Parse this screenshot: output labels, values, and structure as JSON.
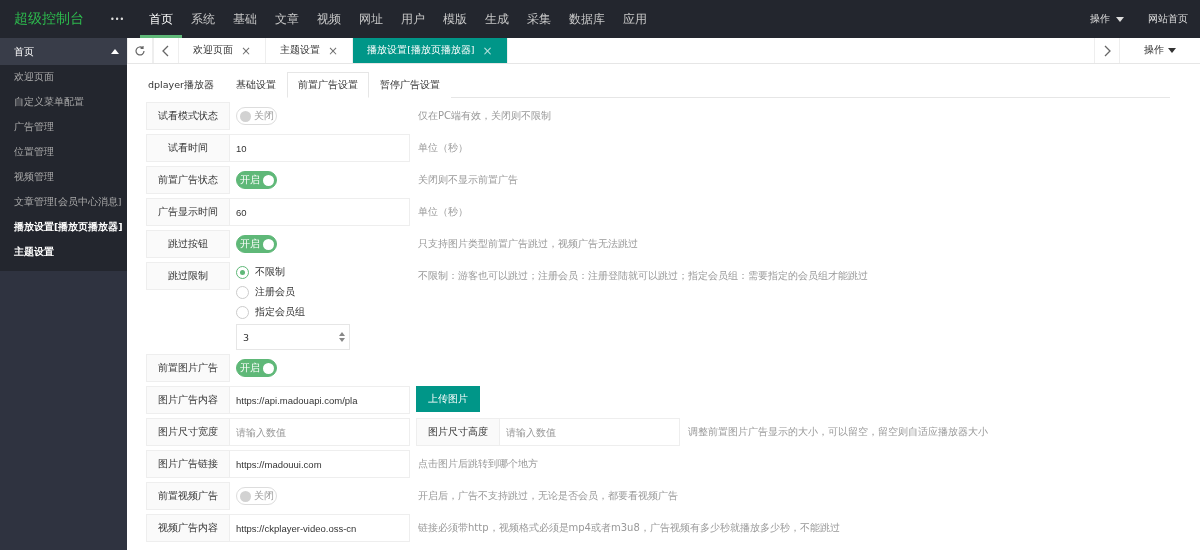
{
  "logo": "超级控制台",
  "more": "•••",
  "nav": [
    {
      "label": "首页",
      "selected": true
    },
    {
      "label": "系统",
      "selected": false
    },
    {
      "label": "基础",
      "selected": false
    },
    {
      "label": "文章",
      "selected": false
    },
    {
      "label": "视频",
      "selected": false
    },
    {
      "label": "网址",
      "selected": false
    },
    {
      "label": "用户",
      "selected": false
    },
    {
      "label": "模版",
      "selected": false
    },
    {
      "label": "生成",
      "selected": false
    },
    {
      "label": "采集",
      "selected": false
    },
    {
      "label": "数据库",
      "selected": false
    },
    {
      "label": "应用",
      "selected": false
    }
  ],
  "top_right": {
    "menu": "操作",
    "link": "网站首页"
  },
  "sidebar": {
    "title": "首页",
    "expanded": true,
    "items": [
      {
        "label": "欢迎页面",
        "active": false
      },
      {
        "label": "自定义菜单配置",
        "active": false
      },
      {
        "label": "广告管理",
        "active": false
      },
      {
        "label": "位置管理",
        "active": false
      },
      {
        "label": "视频管理",
        "active": false
      },
      {
        "label": "文章管理[会员中心消息]",
        "active": false
      },
      {
        "label": "播放设置[播放页播放器]",
        "active": true
      },
      {
        "label": "主题设置",
        "active": true
      }
    ]
  },
  "page_tabs": [
    {
      "label": "欢迎页面",
      "close": "×",
      "selected": false
    },
    {
      "label": "主题设置",
      "close": "×",
      "selected": false
    },
    {
      "label": "播放设置[播放页播放器]",
      "close": "×",
      "selected": true
    }
  ],
  "page_tabs_menu": "操作",
  "sub_tabs": [
    {
      "label": "dplayer播放器",
      "selected": false
    },
    {
      "label": "基础设置",
      "selected": false
    },
    {
      "label": "前置广告设置",
      "selected": true
    },
    {
      "label": "暂停广告设置",
      "selected": false
    }
  ],
  "rows": [
    {
      "kind": "switch",
      "label": "试看模式状态",
      "on": false,
      "switch_text": "关闭",
      "hint": "仅在PC端有效，关闭则不限制"
    },
    {
      "kind": "input",
      "label": "试看时间",
      "value": "10",
      "hint": "单位（秒）"
    },
    {
      "kind": "switch",
      "label": "前置广告状态",
      "on": true,
      "switch_text": "开启",
      "hint": "关闭则不显示前置广告"
    },
    {
      "kind": "input",
      "label": "广告显示时间",
      "value": "60",
      "hint": "单位（秒）"
    },
    {
      "kind": "switch",
      "label": "跳过按钮",
      "on": true,
      "switch_text": "开启",
      "hint": "只支持图片类型前置广告跳过，视频广告无法跳过"
    },
    {
      "kind": "radio",
      "label": "跳过限制",
      "options": [
        {
          "label": "不限制",
          "selected": true
        },
        {
          "label": "注册会员",
          "selected": false
        },
        {
          "label": "指定会员组",
          "selected": false
        }
      ],
      "number": "3",
      "hint": "不限制：游客也可以跳过；注册会员：注册登陆就可以跳过；指定会员组：需要指定的会员组才能跳过"
    },
    {
      "kind": "switch",
      "label": "前置图片广告",
      "on": true,
      "switch_text": "开启"
    },
    {
      "kind": "upload",
      "label": "图片广告内容",
      "value": "https://api.madouapi.com/pla",
      "button": "上传图片"
    },
    {
      "kind": "pair",
      "label": "图片尺寸宽度",
      "placeholder": "请输入数值",
      "label_2": "图片尺寸高度",
      "placeholder_2": "请输入数值",
      "hint": "调整前置图片广告显示的大小，可以留空，留空则自适应播放器大小"
    },
    {
      "kind": "input",
      "label": "图片广告链接",
      "value": "https://madouui.com",
      "hint": "点击图片后跳转到哪个地方"
    },
    {
      "kind": "switch",
      "label": "前置视频广告",
      "on": false,
      "switch_text": "关闭",
      "hint": "开启后，广告不支持跳过，无论是否会员，都要看视频广告"
    },
    {
      "kind": "input",
      "label": "视频广告内容",
      "value": "https://ckplayer-video.oss-cn",
      "hint": "链接必须带http，视频格式必须是mp4或者m3u8，广告视频有多少秒就播放多少秒，不能跳过"
    }
  ]
}
